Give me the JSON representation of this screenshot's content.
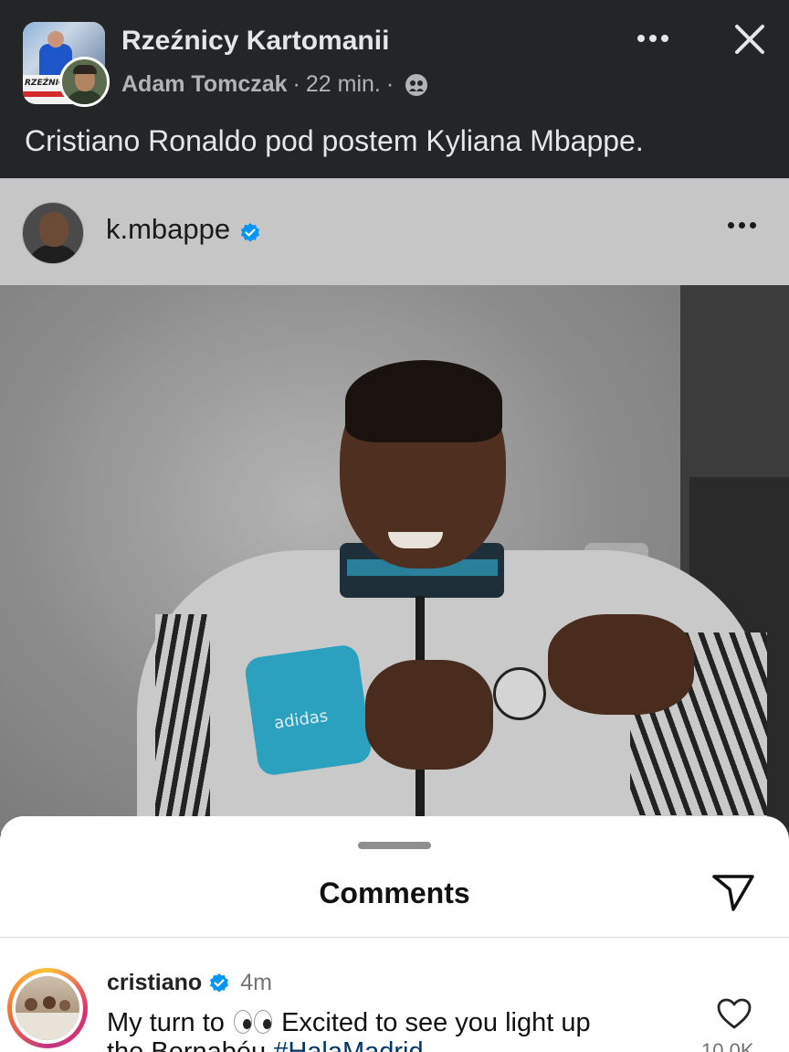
{
  "post": {
    "group_name": "Rzeźnicy Kartomanii",
    "author": "Adam Tomczak",
    "time": "22 min.",
    "separator": "·",
    "text": "Cristiano Ronaldo pod postem Kyliana Mbappe.",
    "group_avatar_label": "RZEŹNICY"
  },
  "instagram": {
    "username": "k.mbappe",
    "photo_text": "adidas"
  },
  "comments_sheet": {
    "title": "Comments",
    "comments": [
      {
        "username": "cristiano",
        "time": "4m",
        "text_before": "My turn to",
        "text_after": "Excited to see you light up",
        "text_line2": "the Bernabéu",
        "hashtag": "#HalaMadrid",
        "likes": "10,0K"
      }
    ]
  },
  "icons": {
    "more": "more-horizontal-icon",
    "close": "close-icon",
    "audience": "group-audience-icon",
    "verified": "verified-badge-icon",
    "send": "send-icon",
    "like": "heart-icon"
  },
  "colors": {
    "fb_background": "#242526",
    "instagram_blue": "#0095f6",
    "hashtag": "#00376b"
  }
}
